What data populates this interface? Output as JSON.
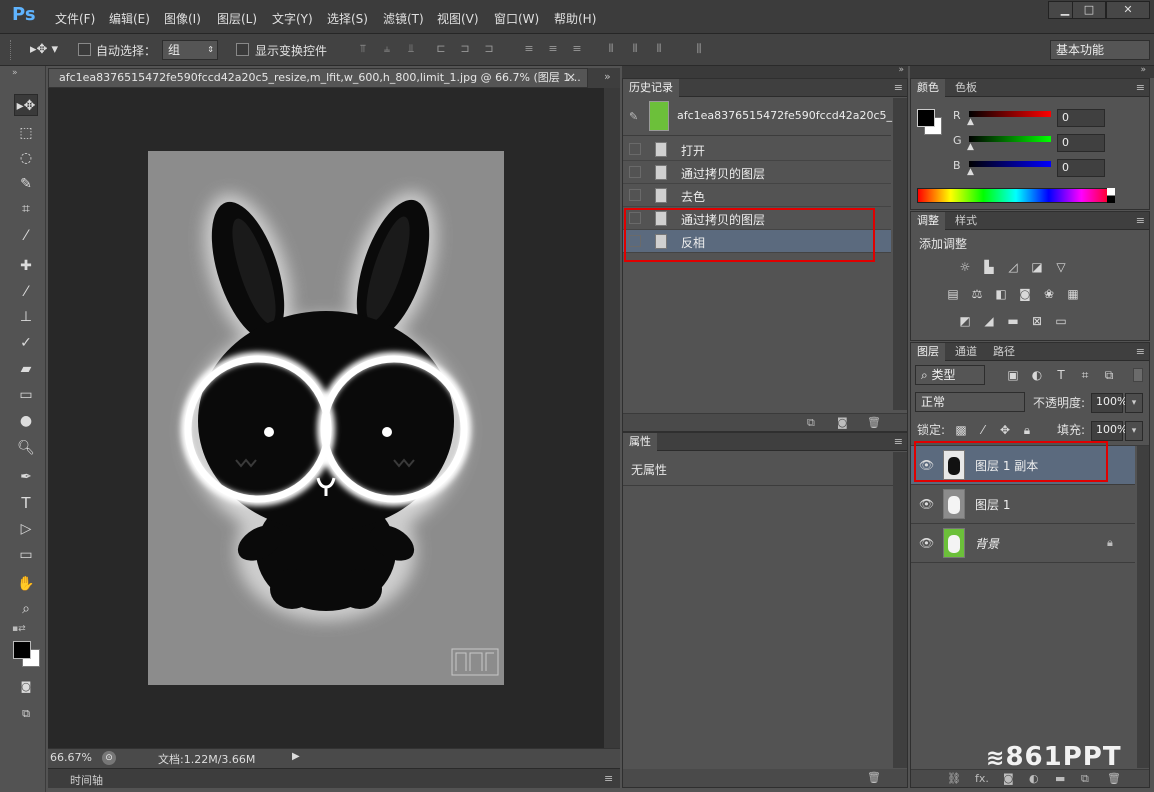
{
  "app": {
    "logo": "Ps"
  },
  "menu": [
    "文件(F)",
    "编辑(E)",
    "图像(I)",
    "图层(L)",
    "文字(Y)",
    "选择(S)",
    "滤镜(T)",
    "视图(V)",
    "窗口(W)",
    "帮助(H)"
  ],
  "window_buttons": {
    "minimize": "▁",
    "maximize": "□",
    "close": "✕"
  },
  "options": {
    "auto_select_label": "自动选择：",
    "auto_select_value": "组",
    "show_transform_label": "显示变换控件",
    "workspace": "基本功能"
  },
  "document": {
    "tab_title": "afc1ea8376515472fe590fccd42a20c5_resize,m_lfit,w_600,h_800,limit_1.jpg @ 66.7% (图层 1...",
    "tab_close": "×",
    "zoom": "66.67%",
    "doc_info": "文档:1.22M/3.66M",
    "timeline_label": "时间轴",
    "watermark": "861PPT"
  },
  "history": {
    "tab": "历史记录",
    "snapshot": "afc1ea8376515472fe590fccd42a20c5_r...",
    "items": [
      "打开",
      "通过拷贝的图层",
      "去色",
      "通过拷贝的图层",
      "反相"
    ]
  },
  "properties": {
    "tab": "属性",
    "empty_text": "无属性"
  },
  "color": {
    "tabs": [
      "颜色",
      "色板"
    ],
    "channels": [
      {
        "label": "R",
        "value": "0"
      },
      {
        "label": "G",
        "value": "0"
      },
      {
        "label": "B",
        "value": "0"
      }
    ]
  },
  "adjustments": {
    "tabs": [
      "调整",
      "样式"
    ],
    "title": "添加调整"
  },
  "layers": {
    "tabs": [
      "图层",
      "通道",
      "路径"
    ],
    "filter_kind": "类型",
    "blend_mode": "正常",
    "opacity_label": "不透明度:",
    "opacity": "100%",
    "lock_label": "锁定:",
    "fill_label": "填充:",
    "fill": "100%",
    "items": [
      {
        "name": "图层 1 副本",
        "selected": true
      },
      {
        "name": "图层 1",
        "selected": false
      },
      {
        "name": "背景",
        "selected": false,
        "locked": true
      }
    ]
  },
  "colors": {
    "selection_red": "#e00000",
    "ps_blue": "#5fb4ff",
    "selected_row": "#5b6a7e"
  }
}
